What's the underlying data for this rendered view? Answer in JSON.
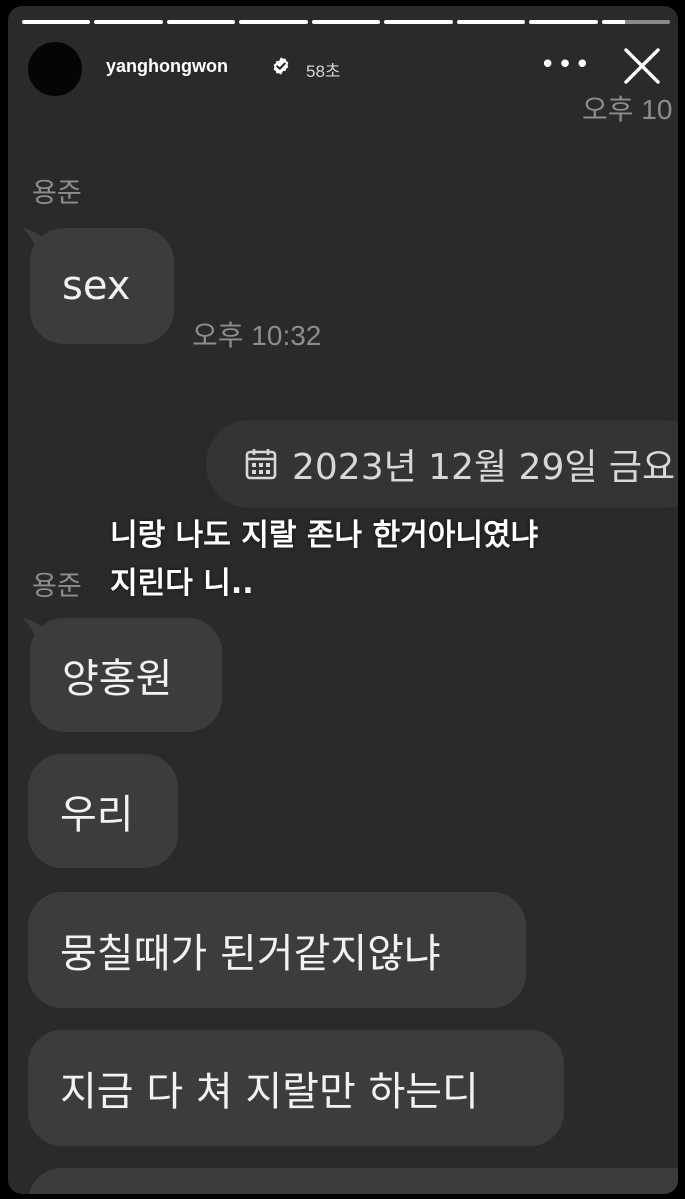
{
  "story": {
    "progress_segments": 9,
    "progress_done": 8,
    "current_segment_fraction": 0.35,
    "username": "yanghongwon",
    "verified": true,
    "time_ago": "58초",
    "more_icon": "more-horizontal-icon",
    "close_icon": "close-icon"
  },
  "chat": {
    "top_timestamp": "오후 10",
    "sender_name_1": "용준",
    "message_1": "sex",
    "timestamp_1": "오후 10:32",
    "date_divider": "2023년 12월 29일 금요",
    "sender_name_2": "용준",
    "messages": [
      "양홍원",
      "우리",
      "뭉칠때가 된거같지않냐",
      "지금 다 쳐 지랄만 하는디"
    ]
  },
  "caption": {
    "line1": "니랑 나도 지랄 존나 한거아니였냐",
    "line2": "지린다 니.."
  },
  "colors": {
    "background": "#2a2a2c",
    "bubble": "#3c3c3e",
    "muted_text": "#8d8d8f"
  }
}
